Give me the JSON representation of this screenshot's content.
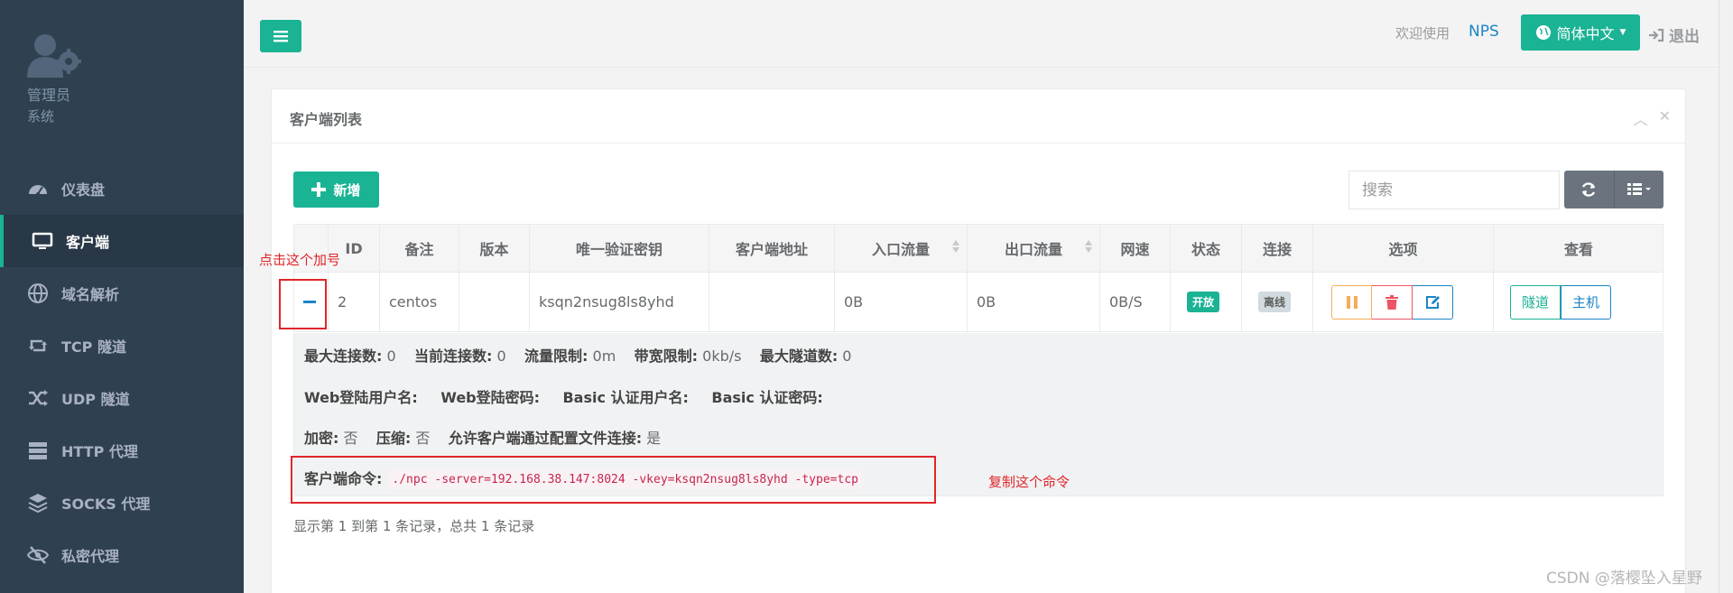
{
  "sidebar": {
    "profile": {
      "name": "管理员",
      "role": "系统"
    },
    "items": [
      {
        "label": "仪表盘",
        "icon": "dashboard-icon"
      },
      {
        "label": "客户端",
        "icon": "monitor-icon",
        "active": true
      },
      {
        "label": "域名解析",
        "icon": "globe-icon"
      },
      {
        "label": "TCP 隧道",
        "icon": "retweet-icon"
      },
      {
        "label": "UDP 隧道",
        "icon": "random-icon"
      },
      {
        "label": "HTTP 代理",
        "icon": "server-icon"
      },
      {
        "label": "SOCKS 代理",
        "icon": "layers-icon"
      },
      {
        "label": "私密代理",
        "icon": "eye-slash-icon"
      }
    ]
  },
  "header": {
    "welcome": "欢迎使用",
    "brand": "NPS",
    "language": "简体中文",
    "logout": "退出"
  },
  "panel": {
    "title": "客户端列表",
    "add_label": "新增",
    "search_placeholder": "搜索"
  },
  "table": {
    "columns": [
      "ID",
      "备注",
      "版本",
      "唯一验证密钥",
      "客户端地址",
      "入口流量",
      "出口流量",
      "网速",
      "状态",
      "连接",
      "选项",
      "查看"
    ],
    "row": {
      "id": "2",
      "remark": "centos",
      "version": "",
      "vkey": "ksqn2nsug8ls8yhd",
      "address": "",
      "in_flow": "0B",
      "out_flow": "0B",
      "speed": "0B/S",
      "status": "开放",
      "connection": "离线",
      "view_tunnel": "隧道",
      "view_host": "主机"
    }
  },
  "detail": {
    "line1": {
      "max_conn_label": "最大连接数:",
      "max_conn": " 0",
      "cur_conn_label": "当前连接数:",
      "cur_conn": " 0",
      "flow_limit_label": "流量限制:",
      "flow_limit": " 0m",
      "rate_limit_label": "带宽限制:",
      "rate_limit": " 0kb/s",
      "max_tunnel_label": "最大隧道数:",
      "max_tunnel": " 0"
    },
    "line2": {
      "web_user_label": "Web登陆用户名:",
      "web_pass_label": "Web登陆密码:",
      "basic_user_label": "Basic 认证用户名:",
      "basic_pass_label": "Basic 认证密码:"
    },
    "line3": {
      "crypt_label": "加密:",
      "crypt": " 否",
      "compress_label": "压缩:",
      "compress": " 否",
      "config_conn_label": "允许客户端通过配置文件连接:",
      "config_conn": " 是"
    },
    "command_label": "客户端命令:",
    "command": "./npc -server=192.168.38.147:8024 -vkey=ksqn2nsug8ls8yhd -type=tcp"
  },
  "footer": "显示第 1 到第 1 条记录，总共 1 条记录",
  "annotations": {
    "plus_hint": "点击这个加号",
    "copy_hint": "复制这个命令"
  },
  "watermark": "CSDN @落樱坠入星野",
  "colors": {
    "primary": "#1ab394",
    "info": "#1c84c6",
    "danger": "#ed5565",
    "warning": "#f8ac59",
    "sidebar": "#2f4050",
    "annotation": "#e0262a"
  }
}
